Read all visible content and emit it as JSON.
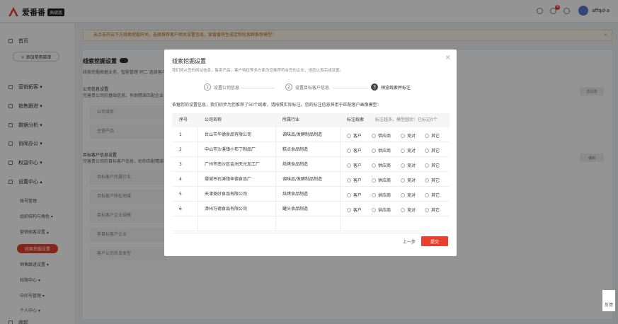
{
  "app": {
    "logo_text": "爱番番",
    "version_badge": "高级版"
  },
  "topbar": {
    "notification_count": "4",
    "username": "affqd-a"
  },
  "sidebar": {
    "home": "首页",
    "quick_menu": "+ 添加常用菜单",
    "items": [
      {
        "label": "营销拓客 ▾"
      },
      {
        "label": "销售跟进 ▾"
      },
      {
        "label": "数据分析 ▾"
      },
      {
        "label": "协同办公 ▾"
      },
      {
        "label": "权益中心 ▾"
      },
      {
        "label": "设置中心 ▴"
      }
    ],
    "sub_items": [
      {
        "label": "账号管理"
      },
      {
        "label": "组织结构与角色 ▾"
      },
      {
        "label": "营销拓客设置 ▴"
      },
      {
        "label": "线索挖掘设置"
      },
      {
        "label": "销售跟进设置 ▾"
      },
      {
        "label": "权限中心 ▾"
      },
      {
        "label": "中间号管理 ▾"
      },
      {
        "label": "个人中心 ▾"
      },
      {
        "label": "收起"
      }
    ]
  },
  "main": {
    "notice": "亲点击开启下方线索挖掘开关，选择推荐客户相关设置信息，爱番番将生成定制化客群推荐模型！",
    "panel_title": "线索挖掘设置",
    "panel_desc": "线索挖掘根据业务，智能管理  同二 选择客户",
    "section1": "公司信息设置",
    "section1_desc": "完善贵公司的基础信息，有助精准匹配企业",
    "row_labels": [
      "公司域名",
      "主营产品"
    ],
    "section2": "目标客户信息设置",
    "section2_desc": "完善贵公司的目标客户信息，助你匹配精准客户",
    "row_labels2": [
      "目标客户所属行业",
      "目标客户所在地域",
      "目标客户企业规模",
      "非目标客户企业",
      "客户公司名单类型"
    ],
    "btn1": "去设置",
    "btn2": "编辑",
    "feedback": "反馈"
  },
  "modal": {
    "title": "线索挖掘设置",
    "subtitle": "我们将从您的网站信息，售卖产品，客户特征等多方面为您推荐符合您的企业，请您认真完成设置。",
    "steps": [
      {
        "num": "1",
        "label": "设置公司信息"
      },
      {
        "num": "2",
        "label": "设置目标客户信息"
      },
      {
        "num": "3",
        "label": "预览线索并标注"
      }
    ],
    "desc": "依据您的设置信息，我们初步为您推荐了50个线索，请按照实际标注。您的标注信息将用于匹配客户画像模型：",
    "columns": {
      "index": "序号",
      "company": "公司名称",
      "industry": "所属行业",
      "mark": "标注线索",
      "hint": "标注越多，模型越优！已标记0个"
    },
    "options": [
      "客户",
      "供应商",
      "竞对",
      "其它"
    ],
    "rows": [
      {
        "index": "1",
        "company": "台山市华德食品有限公司",
        "industry": "调味品/发酵制品制造"
      },
      {
        "index": "2",
        "company": "中山市沙溪镇小布丁制品厂",
        "industry": "糕点食品制造"
      },
      {
        "index": "3",
        "company": "广州市南沙区金洲天元加工厂",
        "industry": "焙烤食品制造"
      },
      {
        "index": "4",
        "company": "增城市石滩镇丰德食品厂",
        "industry": "调味品/发酵制品制造"
      },
      {
        "index": "5",
        "company": "天津美好食品有限公司",
        "industry": "焙烤食品制造"
      },
      {
        "index": "6",
        "company": "漳州万德食品有限公司",
        "industry": "罐头食品制造"
      }
    ],
    "prev": "上一步",
    "submit": "提交"
  }
}
